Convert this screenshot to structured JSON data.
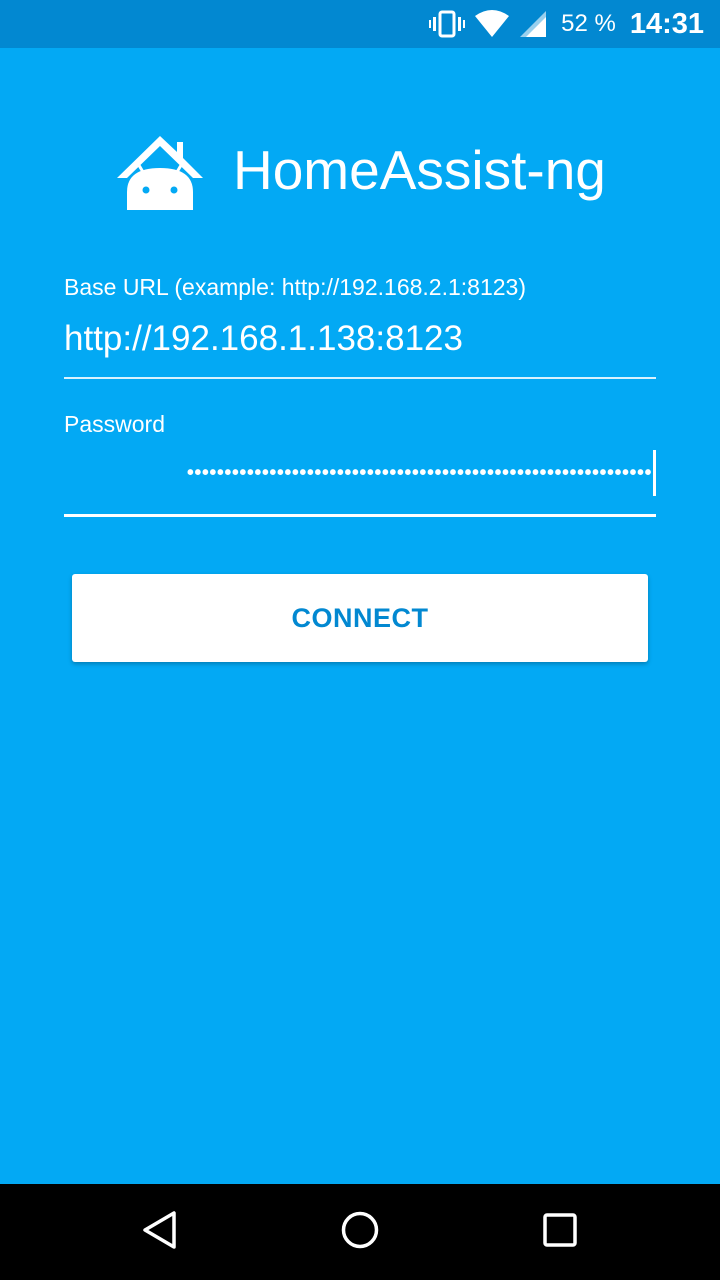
{
  "status_bar": {
    "battery": "52 %",
    "time": "14:31",
    "icons": [
      "vibrate-icon",
      "wifi-icon",
      "cell-signal-icon"
    ]
  },
  "app": {
    "title": "HomeAssist-ng",
    "logo": "house-android-icon"
  },
  "form": {
    "base_url_label": "Base URL (example: http://192.168.2.1:8123)",
    "base_url_value": "http://192.168.1.138:8123",
    "password_label": "Password",
    "password_mask": "••••••••••••••••••••••••••••••••••••••••••••••••••••••••••••••"
  },
  "buttons": {
    "connect_label": "CONNECT"
  },
  "nav_bar": {
    "icons": [
      "back-icon",
      "home-icon",
      "recents-icon"
    ]
  },
  "colors": {
    "background": "#03A9F4",
    "status_bar": "#0288D1",
    "button_text": "#0288D1",
    "nav_bar": "#000000"
  }
}
